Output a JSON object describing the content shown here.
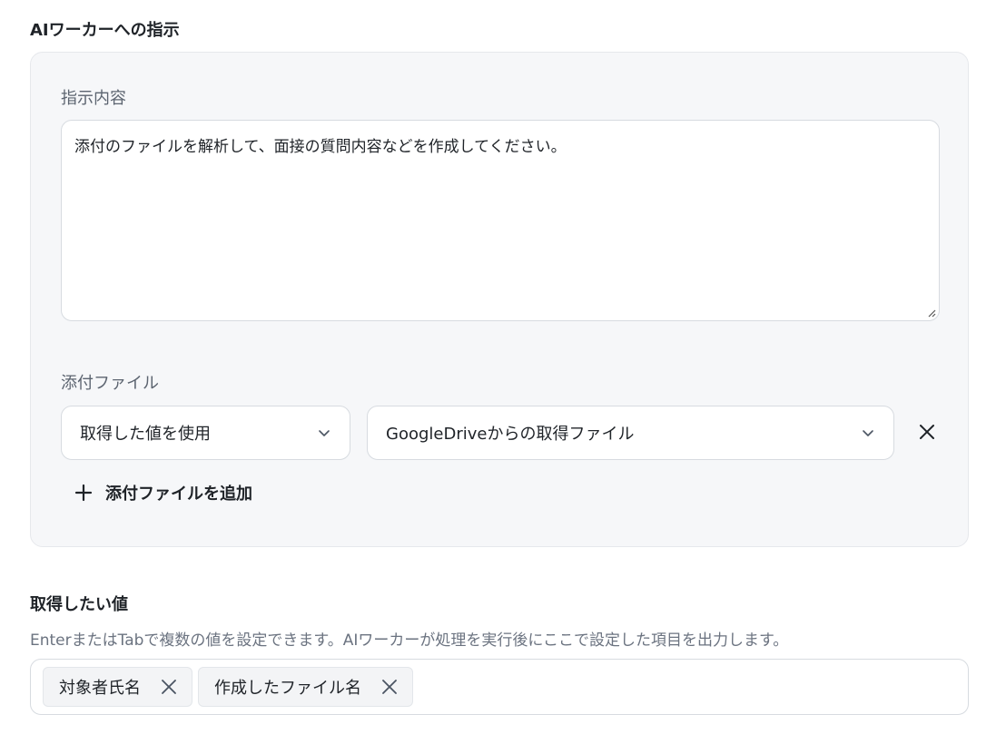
{
  "instruction_section": {
    "title": "AIワーカーへの指示",
    "content_label": "指示内容",
    "content_value": "添付のファイルを解析して、面接の質問内容などを作成してください。",
    "attach_label": "添付ファイル",
    "source_select_value": "取得した値を使用",
    "file_select_value": "GoogleDriveからの取得ファイル",
    "add_attachment_label": "添付ファイルを追加"
  },
  "values_section": {
    "title": "取得したい値",
    "help_text": "EnterまたはTabで複数の値を設定できます。AIワーカーが処理を実行後にここで設定した項目を出力します。",
    "tags": [
      {
        "label": "対象者氏名"
      },
      {
        "label": "作成したファイル名"
      }
    ]
  },
  "icons": {
    "chevron": "chevron-down-icon",
    "remove": "close-icon",
    "add": "plus-icon"
  },
  "colors": {
    "panel_bg": "#f6f7f9",
    "border": "#d7dbe0",
    "text": "#1f2328",
    "muted": "#6b7380"
  }
}
